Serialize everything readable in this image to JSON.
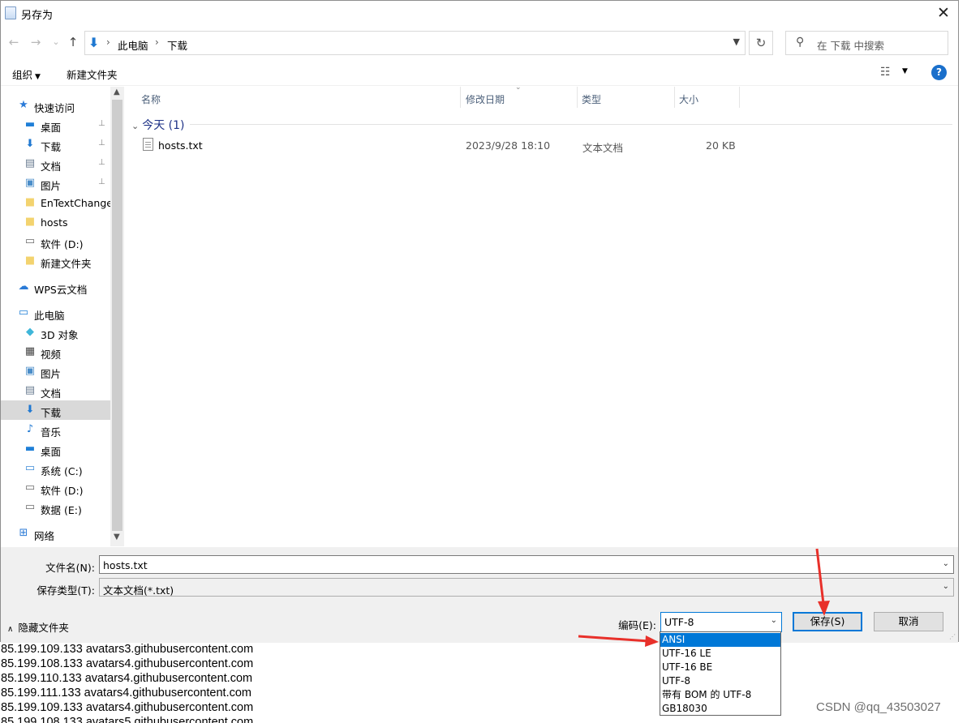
{
  "background_text": [
    "85.199.109.133 avatars3.githubusercontent.com",
    "85.199.108.133 avatars4.githubusercontent.com",
    "85.199.110.133 avatars4.githubusercontent.com",
    "85.199.111.133 avatars4.githubusercontent.com",
    "85.199.109.133 avatars4.githubusercontent.com",
    "85.199.108.133 avatars5.githubusercontent.com"
  ],
  "watermark": "CSDN @qq_43503027",
  "dialog": {
    "title": "另存为",
    "close_glyph": "✕"
  },
  "nav": {
    "back_glyph": "←",
    "forward_glyph": "→",
    "recent_glyph": "⌄",
    "up_glyph": "↑",
    "breadcrumbs": [
      "此电脑",
      "下载"
    ],
    "crumb_separator": "›",
    "refresh_glyph": "↻",
    "search_placeholder": "在 下载 中搜索"
  },
  "toolbar": {
    "organize": "组织",
    "new_folder": "新建文件夹",
    "help": "?"
  },
  "sidebar": {
    "items": [
      {
        "label": "快速访问",
        "icon": "star-icon",
        "glyph": "★",
        "color": "#2b7bd8",
        "indent": 0,
        "pinned": false,
        "selected": false
      },
      {
        "label": "桌面",
        "icon": "desktop-icon",
        "glyph": "▬",
        "color": "#1f7fd7",
        "indent": 1,
        "pinned": true,
        "selected": false
      },
      {
        "label": "下载",
        "icon": "download-icon",
        "glyph": "⬇",
        "color": "#1f78d1",
        "indent": 1,
        "pinned": true,
        "selected": false
      },
      {
        "label": "文档",
        "icon": "document-icon",
        "glyph": "▤",
        "color": "#6b7d92",
        "indent": 1,
        "pinned": true,
        "selected": false
      },
      {
        "label": "图片",
        "icon": "pictures-icon",
        "glyph": "▣",
        "color": "#4b8ec9",
        "indent": 1,
        "pinned": true,
        "selected": false
      },
      {
        "label": "EnTextChange_",
        "icon": "folder-icon",
        "glyph": "■",
        "color": "#f3d36f",
        "indent": 1,
        "pinned": false,
        "selected": false
      },
      {
        "label": "hosts",
        "icon": "folder-icon",
        "glyph": "■",
        "color": "#f3d36f",
        "indent": 1,
        "pinned": false,
        "selected": false
      },
      {
        "label": "软件 (D:)",
        "icon": "drive-icon",
        "glyph": "▭",
        "color": "#6a6a6a",
        "indent": 1,
        "pinned": false,
        "selected": false
      },
      {
        "label": "新建文件夹",
        "icon": "folder-icon",
        "glyph": "■",
        "color": "#f3d36f",
        "indent": 1,
        "pinned": false,
        "selected": false
      },
      {
        "label": "WPS云文档",
        "icon": "cloud-icon",
        "glyph": "☁",
        "color": "#2a7ad6",
        "indent": 0,
        "pinned": false,
        "selected": false
      },
      {
        "label": "此电脑",
        "icon": "computer-icon",
        "glyph": "▭",
        "color": "#1f7fd7",
        "indent": 0,
        "pinned": false,
        "selected": false
      },
      {
        "label": "3D 对象",
        "icon": "3d-objects-icon",
        "glyph": "◆",
        "color": "#3fb6d9",
        "indent": 1,
        "pinned": false,
        "selected": false
      },
      {
        "label": "视频",
        "icon": "video-icon",
        "glyph": "▦",
        "color": "#444444",
        "indent": 1,
        "pinned": false,
        "selected": false
      },
      {
        "label": "图片",
        "icon": "pictures-icon",
        "glyph": "▣",
        "color": "#4b8ec9",
        "indent": 1,
        "pinned": false,
        "selected": false
      },
      {
        "label": "文档",
        "icon": "document-icon",
        "glyph": "▤",
        "color": "#6b7d92",
        "indent": 1,
        "pinned": false,
        "selected": false
      },
      {
        "label": "下载",
        "icon": "download-icon",
        "glyph": "⬇",
        "color": "#1f78d1",
        "indent": 1,
        "pinned": false,
        "selected": true
      },
      {
        "label": "音乐",
        "icon": "music-icon",
        "glyph": "♪",
        "color": "#1f78d1",
        "indent": 1,
        "pinned": false,
        "selected": false
      },
      {
        "label": "桌面",
        "icon": "desktop-icon",
        "glyph": "▬",
        "color": "#1f7fd7",
        "indent": 1,
        "pinned": false,
        "selected": false
      },
      {
        "label": "系统 (C:)",
        "icon": "system-drive-icon",
        "glyph": "▭",
        "color": "#3b8ad6",
        "indent": 1,
        "pinned": false,
        "selected": false
      },
      {
        "label": "软件 (D:)",
        "icon": "drive-icon",
        "glyph": "▭",
        "color": "#6a6a6a",
        "indent": 1,
        "pinned": false,
        "selected": false
      },
      {
        "label": "数据 (E:)",
        "icon": "drive-icon",
        "glyph": "▭",
        "color": "#6a6a6a",
        "indent": 1,
        "pinned": false,
        "selected": false
      },
      {
        "label": "网络",
        "icon": "network-icon",
        "glyph": "⊞",
        "color": "#2a7ad6",
        "indent": 0,
        "pinned": false,
        "selected": false
      }
    ]
  },
  "filelist": {
    "columns": [
      "名称",
      "修改日期",
      "类型",
      "大小"
    ],
    "group": "今天 (1)",
    "files": [
      {
        "name": "hosts.txt",
        "modified": "2023/9/28 18:10",
        "type": "文本文档",
        "size": "20 KB"
      }
    ]
  },
  "form": {
    "filename_label": "文件名(N):",
    "filename_value": "hosts.txt",
    "filetype_label": "保存类型(T):",
    "filetype_value": "文本文档(*.txt)",
    "hide_folders": "隐藏文件夹",
    "encoding_label": "编码(E):",
    "encoding_value": "UTF-8",
    "save_button": "保存(S)",
    "cancel_button": "取消"
  },
  "encoding_options": [
    "ANSI",
    "UTF-16 LE",
    "UTF-16 BE",
    "UTF-8",
    "带有 BOM 的 UTF-8",
    "GB18030"
  ],
  "highlighted_option": "ANSI",
  "colors": {
    "accent": "#0078d7",
    "annotation_arrow": "#e8302a"
  }
}
